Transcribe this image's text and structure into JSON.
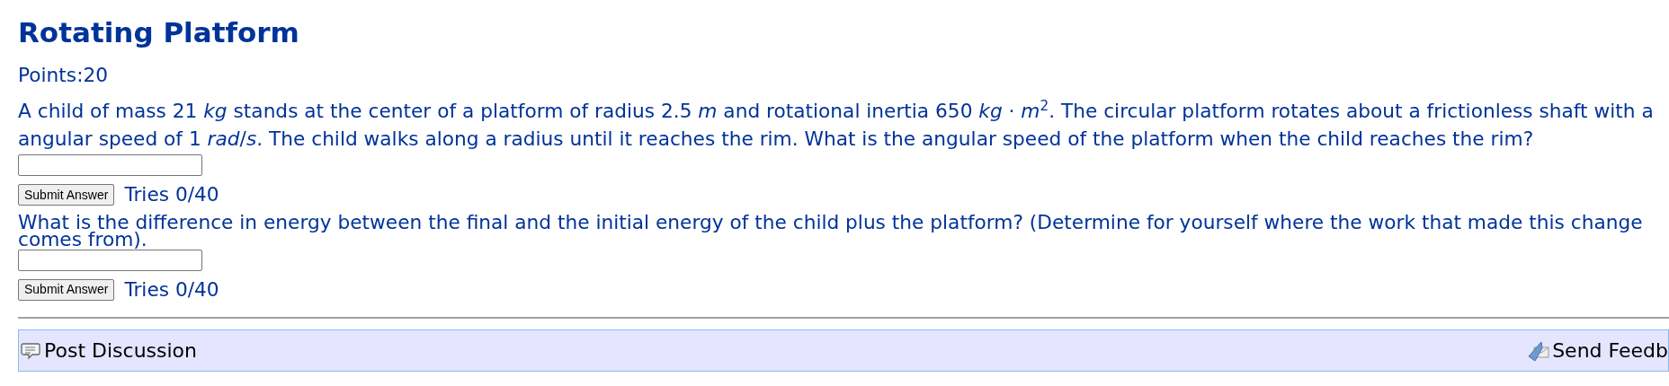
{
  "title": "Rotating Platform",
  "points": "Points:20",
  "questions": [
    {
      "lines": [
        "A child of mass 21 *kg* stands at the center of a platform of radius 2.5 *m* and rotational inertia 650 *kg* · *m*$^{2}$. The circular platform rotates about a frictionless shaft with a",
        "angular speed of 1 *rad*/*s*. The child walks along a radius until it reaches the rim. What is the angular speed of the platform when the child reaches the rim?"
      ],
      "button": "Submit Answer",
      "tries": "Tries 0/40"
    },
    {
      "lines": [
        "What is the difference in energy between the final and the initial energy of the child plus the platform? (Determine for yourself where the work that made this change",
        "comes from)."
      ],
      "button": "Submit Answer",
      "tries": "Tries 0/40"
    }
  ],
  "footer": {
    "left": "Post Discussion",
    "right": "Send Feedb"
  }
}
